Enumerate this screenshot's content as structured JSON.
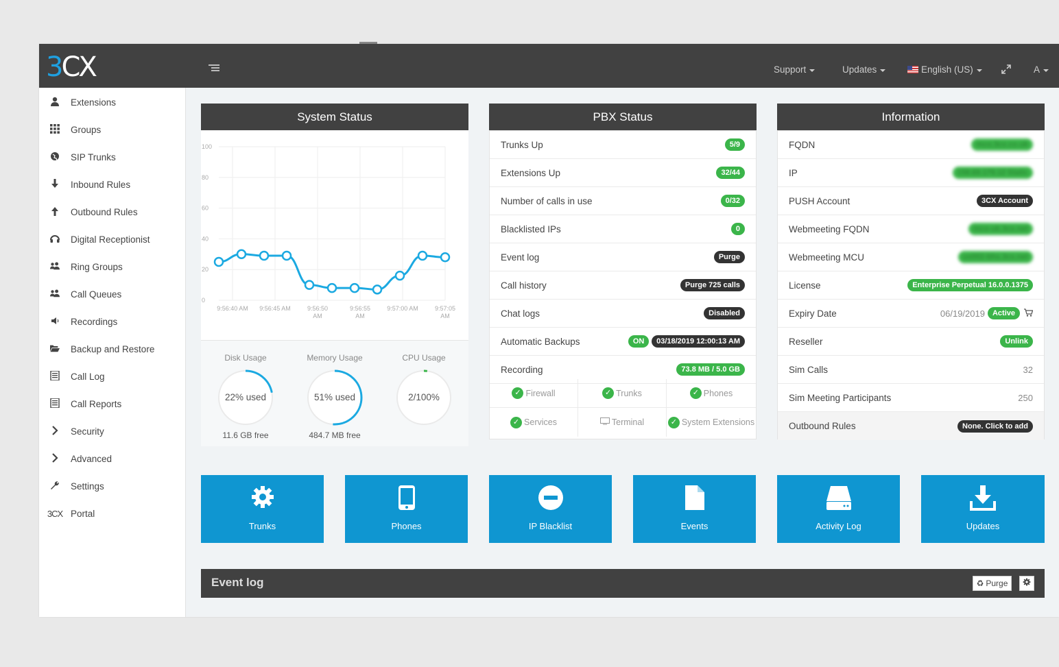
{
  "topbar": {
    "logo": "3CX",
    "support": "Support",
    "updates": "Updates",
    "language": "English (US)",
    "user": "A"
  },
  "sidebar": {
    "items": [
      {
        "label": "Extensions",
        "icon": "user-icon"
      },
      {
        "label": "Groups",
        "icon": "grid-icon"
      },
      {
        "label": "SIP Trunks",
        "icon": "globe-icon"
      },
      {
        "label": "Inbound Rules",
        "icon": "arrow-down-icon"
      },
      {
        "label": "Outbound Rules",
        "icon": "arrow-up-icon"
      },
      {
        "label": "Digital Receptionist",
        "icon": "headset-icon"
      },
      {
        "label": "Ring Groups",
        "icon": "users-icon"
      },
      {
        "label": "Call Queues",
        "icon": "users-icon"
      },
      {
        "label": "Recordings",
        "icon": "speaker-icon"
      },
      {
        "label": "Backup and Restore",
        "icon": "folder-open-icon"
      },
      {
        "label": "Call Log",
        "icon": "list-icon"
      },
      {
        "label": "Call Reports",
        "icon": "list-icon"
      },
      {
        "label": "Security",
        "icon": "chevron-right-icon"
      },
      {
        "label": "Advanced",
        "icon": "chevron-right-icon"
      },
      {
        "label": "Settings",
        "icon": "wrench-icon"
      },
      {
        "label": "Portal",
        "icon": "3cx-logo-icon"
      }
    ]
  },
  "system_status": {
    "title": "System Status",
    "disk": {
      "title": "Disk Usage",
      "used": "22% used",
      "free": "11.6 GB free",
      "fraction": 0.22
    },
    "memory": {
      "title": "Memory Usage",
      "used": "51% used",
      "free": "484.7 MB free",
      "fraction": 0.51
    },
    "cpu": {
      "title": "CPU Usage",
      "used": "2/100%",
      "fraction": 0.02
    }
  },
  "chart_data": {
    "type": "line",
    "x_ticks": [
      "9:56:40 AM",
      "9:56:45 AM",
      "9:56:50 AM",
      "9:56:55 AM",
      "9:57:00 AM",
      "9:57:05 AM"
    ],
    "yticks": [
      0,
      20,
      40,
      60,
      80,
      100
    ],
    "ylim": [
      0,
      100
    ],
    "values": [
      25,
      30,
      29,
      29,
      10,
      8,
      8,
      7,
      16,
      29,
      28
    ],
    "color": "#1ba9e1",
    "grid": true
  },
  "pbx_status": {
    "title": "PBX Status",
    "rows": [
      {
        "label": "Trunks Up",
        "value": "5/9"
      },
      {
        "label": "Extensions Up",
        "value": "32/44"
      },
      {
        "label": "Number of calls in use",
        "value": "0/32"
      },
      {
        "label": "Blacklisted IPs",
        "value": "0"
      },
      {
        "label": "Event log",
        "value": "Purge"
      },
      {
        "label": "Call history",
        "value": "Purge 725 calls"
      },
      {
        "label": "Chat logs",
        "value": "Disabled"
      },
      {
        "label": "Automatic Backups",
        "on": "ON",
        "value": "03/18/2019 12:00:13 AM"
      },
      {
        "label": "Recording",
        "value": "73.8 MB / 5.0 GB"
      }
    ],
    "services": [
      "Firewall",
      "Trunks",
      "Phones",
      "Services",
      "Terminal",
      "System Extensions"
    ]
  },
  "information": {
    "title": "Information",
    "rows": [
      {
        "label": "FQDN",
        "value": "mco.3cx.co.uk"
      },
      {
        "label": "IP",
        "value": "158.69.179.12 Static"
      },
      {
        "label": "PUSH Account",
        "value": "3CX Account"
      },
      {
        "label": "Webmeeting FQDN",
        "value": "mco-uk.3cx.net"
      },
      {
        "label": "Webmeeting MCU",
        "value": "us002-bhs.3cx.net"
      },
      {
        "label": "License",
        "value": "Enterprise Perpetual 16.0.0.1375"
      },
      {
        "label": "Expiry Date",
        "date": "06/19/2019",
        "value": "Active"
      },
      {
        "label": "Reseller",
        "value": "Unlink"
      },
      {
        "label": "Sim Calls",
        "value": "32"
      },
      {
        "label": "Sim Meeting Participants",
        "value": "250"
      },
      {
        "label": "Outbound Rules",
        "value": "None. Click to add"
      }
    ]
  },
  "tiles": [
    "Trunks",
    "Phones",
    "IP Blacklist",
    "Events",
    "Activity Log",
    "Updates"
  ],
  "eventlog": {
    "title": "Event log",
    "purge": "Purge"
  }
}
